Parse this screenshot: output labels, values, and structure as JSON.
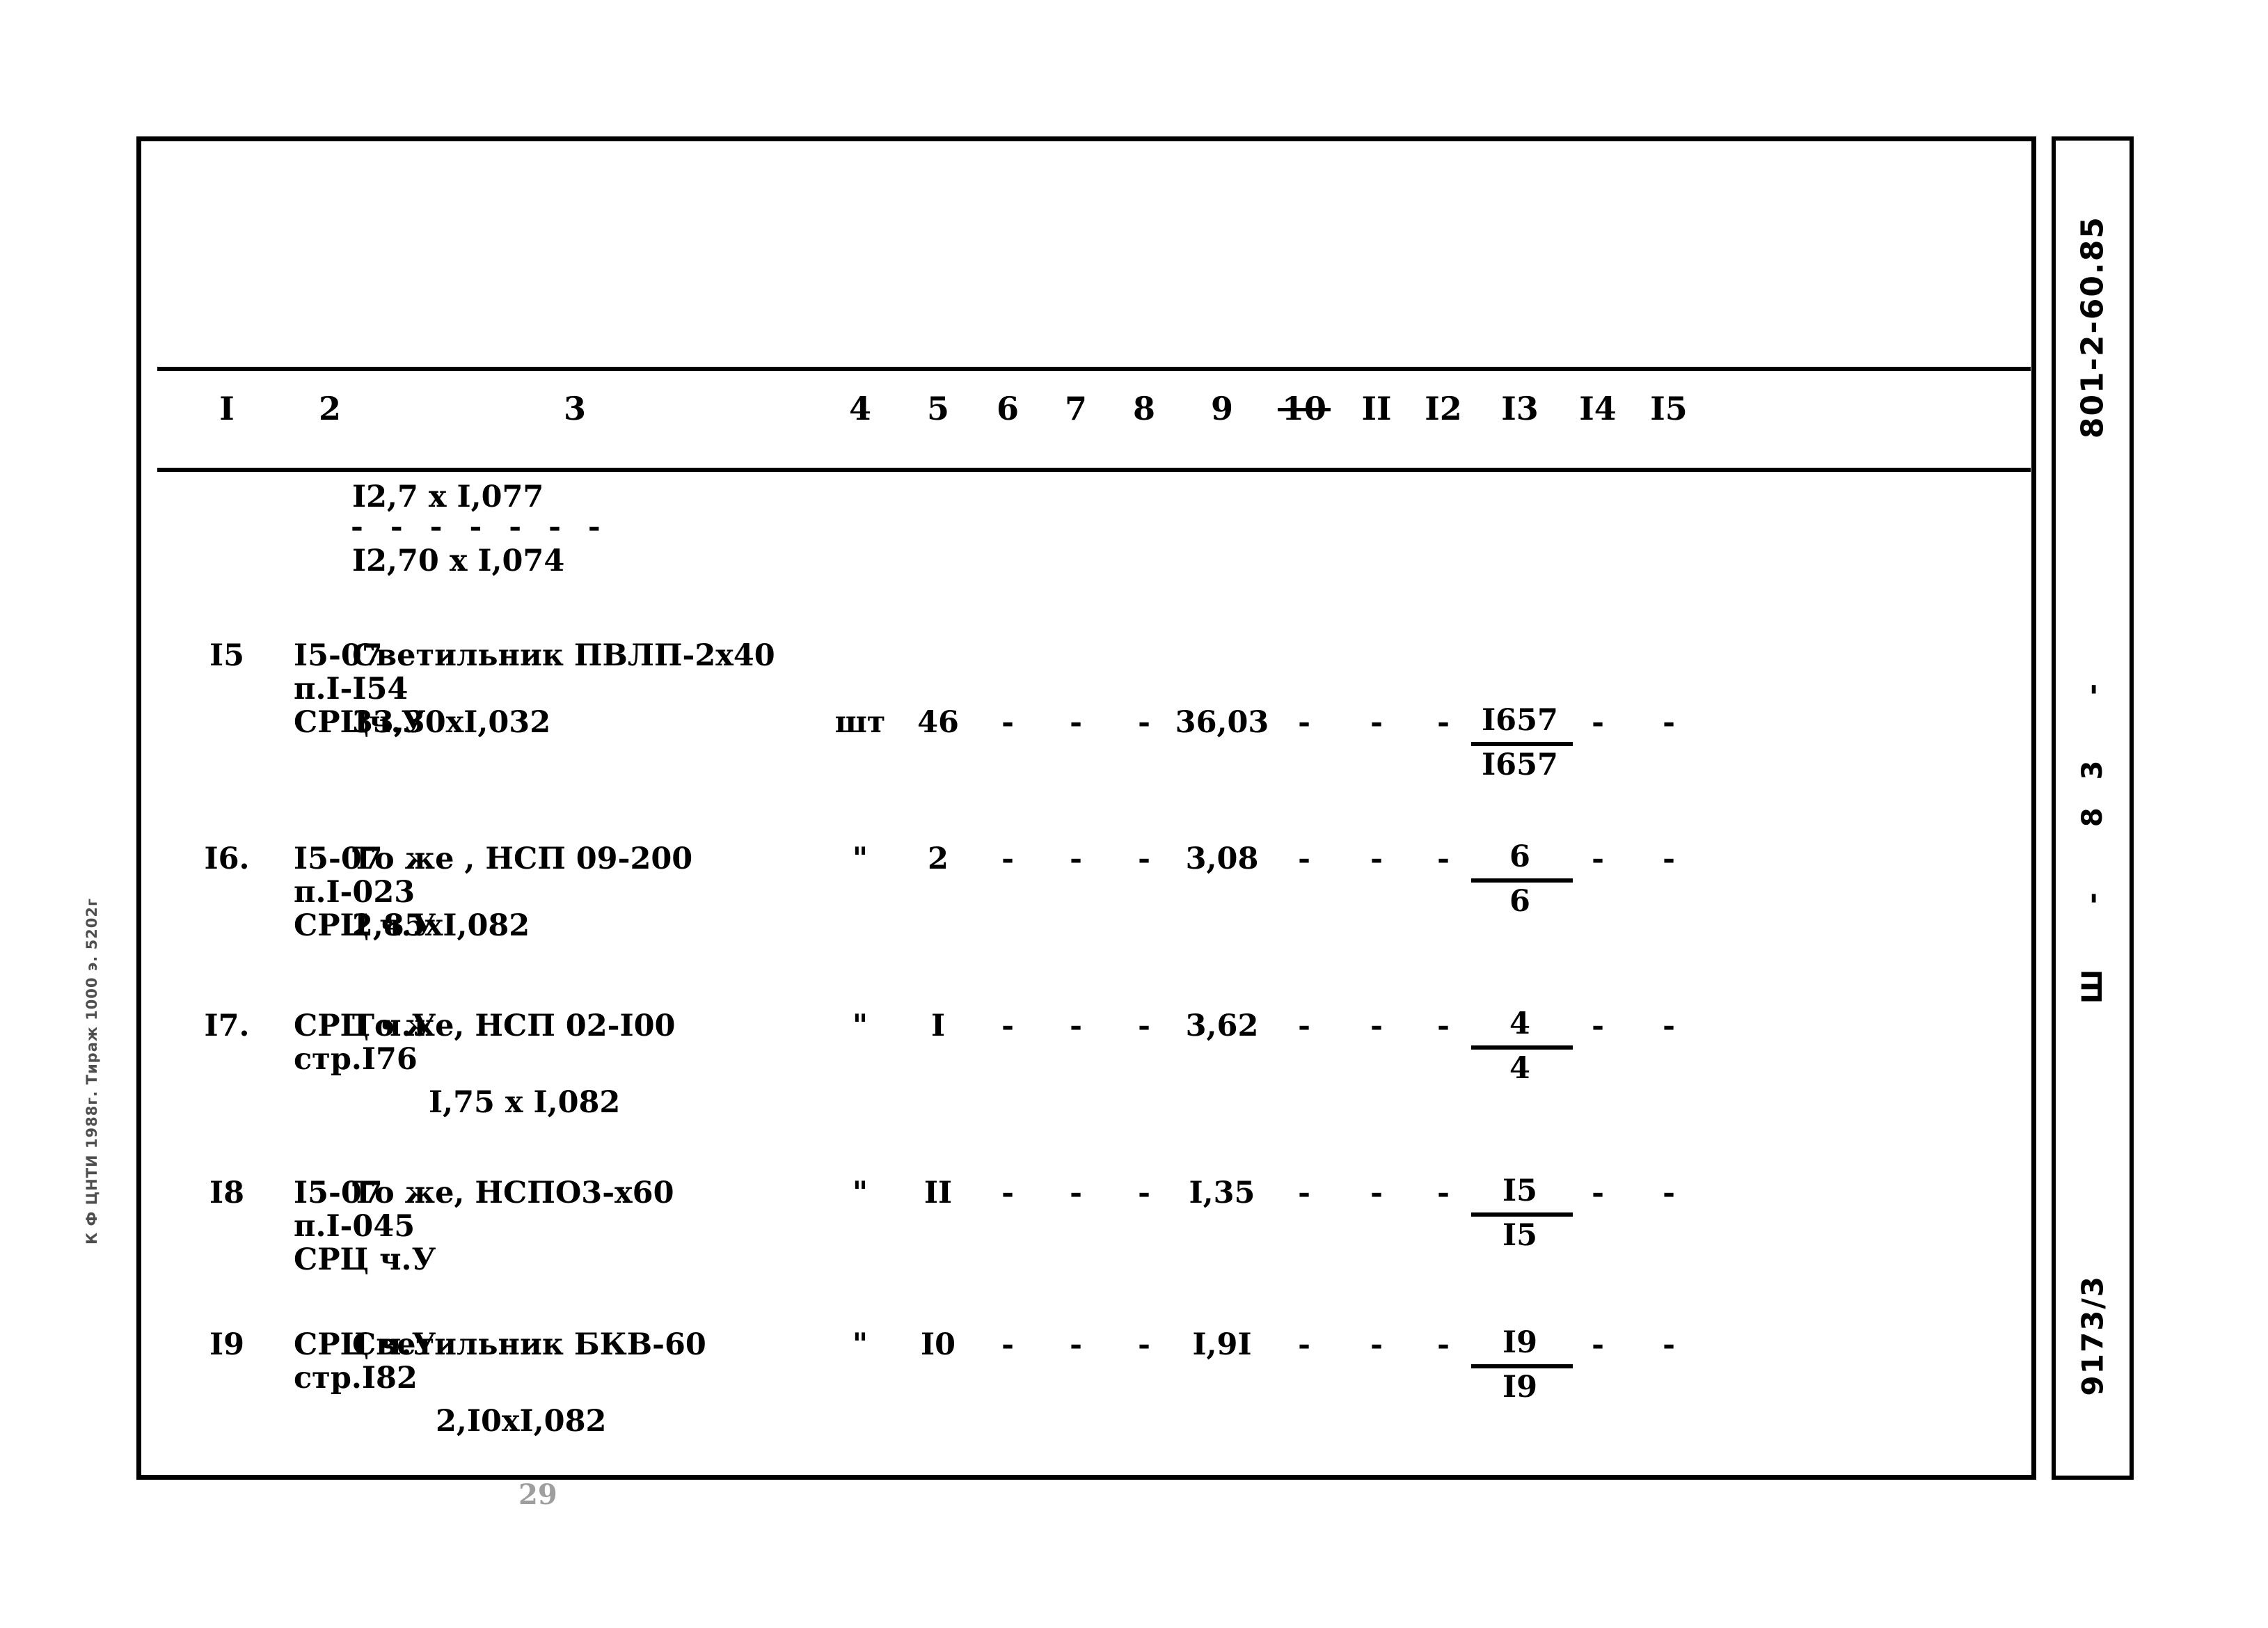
{
  "document": {
    "series_code": "801-2-60.85",
    "series_part": "Ш - 83 -",
    "sheet_code": "9173/3",
    "left_imprint": "К Ф ЦНТИ 1988г. Тираж 1000 э. 5202г",
    "folio": "29"
  },
  "table": {
    "column_headers": [
      {
        "label": "I",
        "struck": false
      },
      {
        "label": "2",
        "struck": false
      },
      {
        "label": "3",
        "struck": false
      },
      {
        "label": "4",
        "struck": false
      },
      {
        "label": "5",
        "struck": false
      },
      {
        "label": "6",
        "struck": false
      },
      {
        "label": "7",
        "struck": false
      },
      {
        "label": "8",
        "struck": false
      },
      {
        "label": "9",
        "struck": false
      },
      {
        "label": "10",
        "struck": true
      },
      {
        "label": "II",
        "struck": false
      },
      {
        "label": "I2",
        "struck": false
      },
      {
        "label": "I3",
        "struck": false
      },
      {
        "label": "I4",
        "struck": false
      },
      {
        "label": "I5",
        "struck": false
      }
    ],
    "continuation": {
      "numerator": "I2,7 x I,077",
      "divider": "- - - - - - -",
      "denominator": "I2,70 x I,074"
    },
    "rows": [
      {
        "no": "I5",
        "ref_line1": "I5-07",
        "ref_line2": "п.I-I54",
        "ref_line3": "СРЦч.У",
        "desc_line1": "Светильник ПВЛП-2х40",
        "desc_line2": "33,30хI,032",
        "unit": "шт",
        "qty": "46",
        "c6": "-",
        "c7": "-",
        "c8": "-",
        "c9": "36,03",
        "c10": "-",
        "c11": "-",
        "c12": "-",
        "c13_num": "I657",
        "c13_den": "I657",
        "c14": "-",
        "c15": "-"
      },
      {
        "no": "I6.",
        "ref_line1": "I5-07",
        "ref_line2": "п.I-023",
        "ref_line3": "СРЦ ч.У",
        "desc_line1": "То же , НСП 09-200",
        "desc_line2": "2,85хI,082",
        "unit": "\"",
        "qty": "2",
        "c6": "-",
        "c7": "-",
        "c8": "-",
        "c9": "3,08",
        "c10": "-",
        "c11": "-",
        "c12": "-",
        "c13_num": "6",
        "c13_den": "6",
        "c14": "-",
        "c15": "-"
      },
      {
        "no": "I7.",
        "ref_line1": "СРЦ ч.У",
        "ref_line2": "стр.I76",
        "ref_line3": "",
        "desc_line1": "То же, НСП 02-I00",
        "desc_line2": "I,75 x I,082",
        "unit": "\"",
        "qty": "I",
        "c6": "-",
        "c7": "-",
        "c8": "-",
        "c9": "3,62",
        "c10": "-",
        "c11": "-",
        "c12": "-",
        "c13_num": "4",
        "c13_den": "4",
        "c14": "-",
        "c15": "-"
      },
      {
        "no": "I8",
        "ref_line1": "I5-07",
        "ref_line2": "п.I-045",
        "ref_line3": "СРЦ ч.У",
        "desc_line1": "То же, НСПО3-х60",
        "desc_line2": "",
        "unit": "\"",
        "qty": "II",
        "c6": "-",
        "c7": "-",
        "c8": "-",
        "c9": "I,35",
        "c10": "-",
        "c11": "-",
        "c12": "-",
        "c13_num": "I5",
        "c13_den": "I5",
        "c14": "-",
        "c15": "-"
      },
      {
        "no": "I9",
        "ref_line1": "СРЦ ч.У",
        "ref_line2": "стр.I82",
        "ref_line3": "",
        "desc_line1": "Светильник БКВ-60",
        "desc_line2": "2,I0хI,082",
        "unit": "\"",
        "qty": "I0",
        "c6": "-",
        "c7": "-",
        "c8": "-",
        "c9": "I,9I",
        "c10": "-",
        "c11": "-",
        "c12": "-",
        "c13_num": "I9",
        "c13_den": "I9",
        "c14": "-",
        "c15": "-"
      }
    ]
  }
}
